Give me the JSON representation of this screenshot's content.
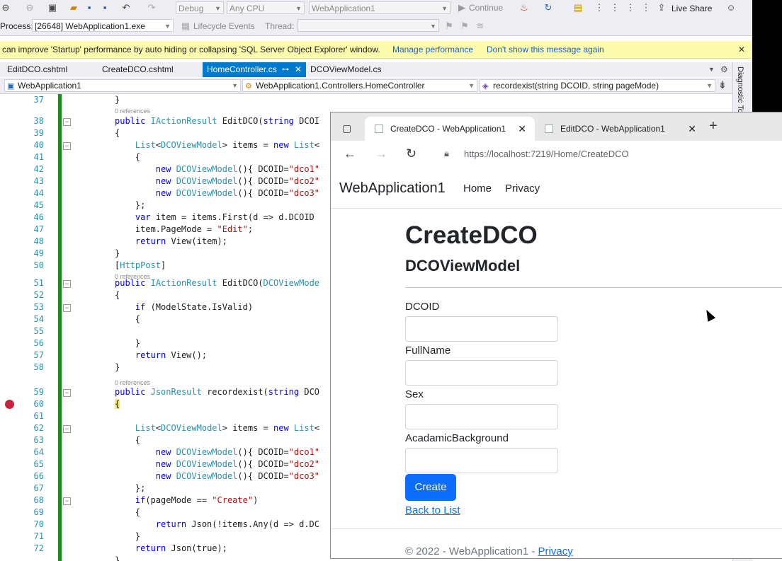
{
  "toolbar": {
    "config": "Debug",
    "platform": "Any CPU",
    "startup_project": "WebApplication1",
    "continue_label": "Continue",
    "live_share_label": "Live Share",
    "process_label": "Process:",
    "process_value": "[26648] WebApplication1.exe",
    "lifecycle_label": "Lifecycle Events",
    "thread_label": "Thread:"
  },
  "infobar": {
    "message": "can improve 'Startup' performance by auto hiding or collapsing 'SQL Server Object Explorer' window.",
    "link1": "Manage performance",
    "link2": "Don't show this message again",
    "close": "✕"
  },
  "doc_tabs": [
    {
      "label": "EditDCO.cshtml"
    },
    {
      "label": "CreateDCO.cshtml"
    },
    {
      "label": "HomeController.cs"
    },
    {
      "label": "DCOViewModel.cs"
    }
  ],
  "navbar": {
    "project": "WebApplication1",
    "class": "WebApplication1.Controllers.HomeController",
    "member": "recordexist(string DCOID, string pageMode)"
  },
  "side_panel": {
    "label": "Diagnostic To"
  },
  "refs_label": "0 references",
  "code_lines": [
    {
      "n": "37",
      "t": "}"
    },
    {
      "n": "38",
      "t": "public IActionResult EditDCO(string DCOI"
    },
    {
      "n": "39",
      "t": "{"
    },
    {
      "n": "40",
      "t": "    List<DCOViewModel> items = new List<"
    },
    {
      "n": "41",
      "t": "    {"
    },
    {
      "n": "42",
      "t": "        new DCOViewModel(){ DCOID=\"dco1\""
    },
    {
      "n": "43",
      "t": "        new DCOViewModel(){ DCOID=\"dco2\""
    },
    {
      "n": "44",
      "t": "        new DCOViewModel(){ DCOID=\"dco3\""
    },
    {
      "n": "45",
      "t": "    };"
    },
    {
      "n": "46",
      "t": "    var item = items.First(d => d.DCOID"
    },
    {
      "n": "47",
      "t": "    item.PageMode = \"Edit\";"
    },
    {
      "n": "48",
      "t": "    return View(item);"
    },
    {
      "n": "49",
      "t": "}"
    },
    {
      "n": "50",
      "t": "[HttpPost]"
    },
    {
      "n": "51",
      "t": "public IActionResult EditDCO(DCOViewMode"
    },
    {
      "n": "52",
      "t": "{"
    },
    {
      "n": "53",
      "t": "    if (ModelState.IsValid)"
    },
    {
      "n": "54",
      "t": "    {"
    },
    {
      "n": "55",
      "t": ""
    },
    {
      "n": "56",
      "t": "    }"
    },
    {
      "n": "57",
      "t": "    return View();"
    },
    {
      "n": "58",
      "t": "}"
    },
    {
      "n": "59",
      "t": "public JsonResult recordexist(string DCO"
    },
    {
      "n": "60",
      "t": "{"
    },
    {
      "n": "61",
      "t": ""
    },
    {
      "n": "62",
      "t": "    List<DCOViewModel> items = new List<"
    },
    {
      "n": "63",
      "t": "    {"
    },
    {
      "n": "64",
      "t": "        new DCOViewModel(){ DCOID=\"dco1\""
    },
    {
      "n": "65",
      "t": "        new DCOViewModel(){ DCOID=\"dco2\""
    },
    {
      "n": "66",
      "t": "        new DCOViewModel(){ DCOID=\"dco3\""
    },
    {
      "n": "67",
      "t": "    };"
    },
    {
      "n": "68",
      "t": "    if(pageMode == \"Create\")"
    },
    {
      "n": "69",
      "t": "    {"
    },
    {
      "n": "70",
      "t": "        return Json(!items.Any(d => d.DC"
    },
    {
      "n": "71",
      "t": "    }"
    },
    {
      "n": "72",
      "t": "    return Json(true);"
    },
    {
      "n": "",
      "t": "}"
    }
  ],
  "browser": {
    "tabs": [
      {
        "title": "CreateDCO - WebApplication1"
      },
      {
        "title": "EditDCO - WebApplication1"
      }
    ],
    "new_tab": "+",
    "url": "https://localhost:7219/Home/CreateDCO"
  },
  "page": {
    "brand": "WebApplication1",
    "nav": [
      {
        "label": "Home"
      },
      {
        "label": "Privacy"
      }
    ],
    "heading": "CreateDCO",
    "subheading": "DCOViewModel",
    "fields": [
      {
        "label": "DCOID",
        "value": ""
      },
      {
        "label": "FullName",
        "value": ""
      },
      {
        "label": "Sex",
        "value": ""
      },
      {
        "label": "AcadamicBackground",
        "value": ""
      }
    ],
    "submit_label": "Create",
    "back_link": "Back to List",
    "footer_text": "© 2022 - WebApplication1 - ",
    "footer_link": "Privacy"
  }
}
